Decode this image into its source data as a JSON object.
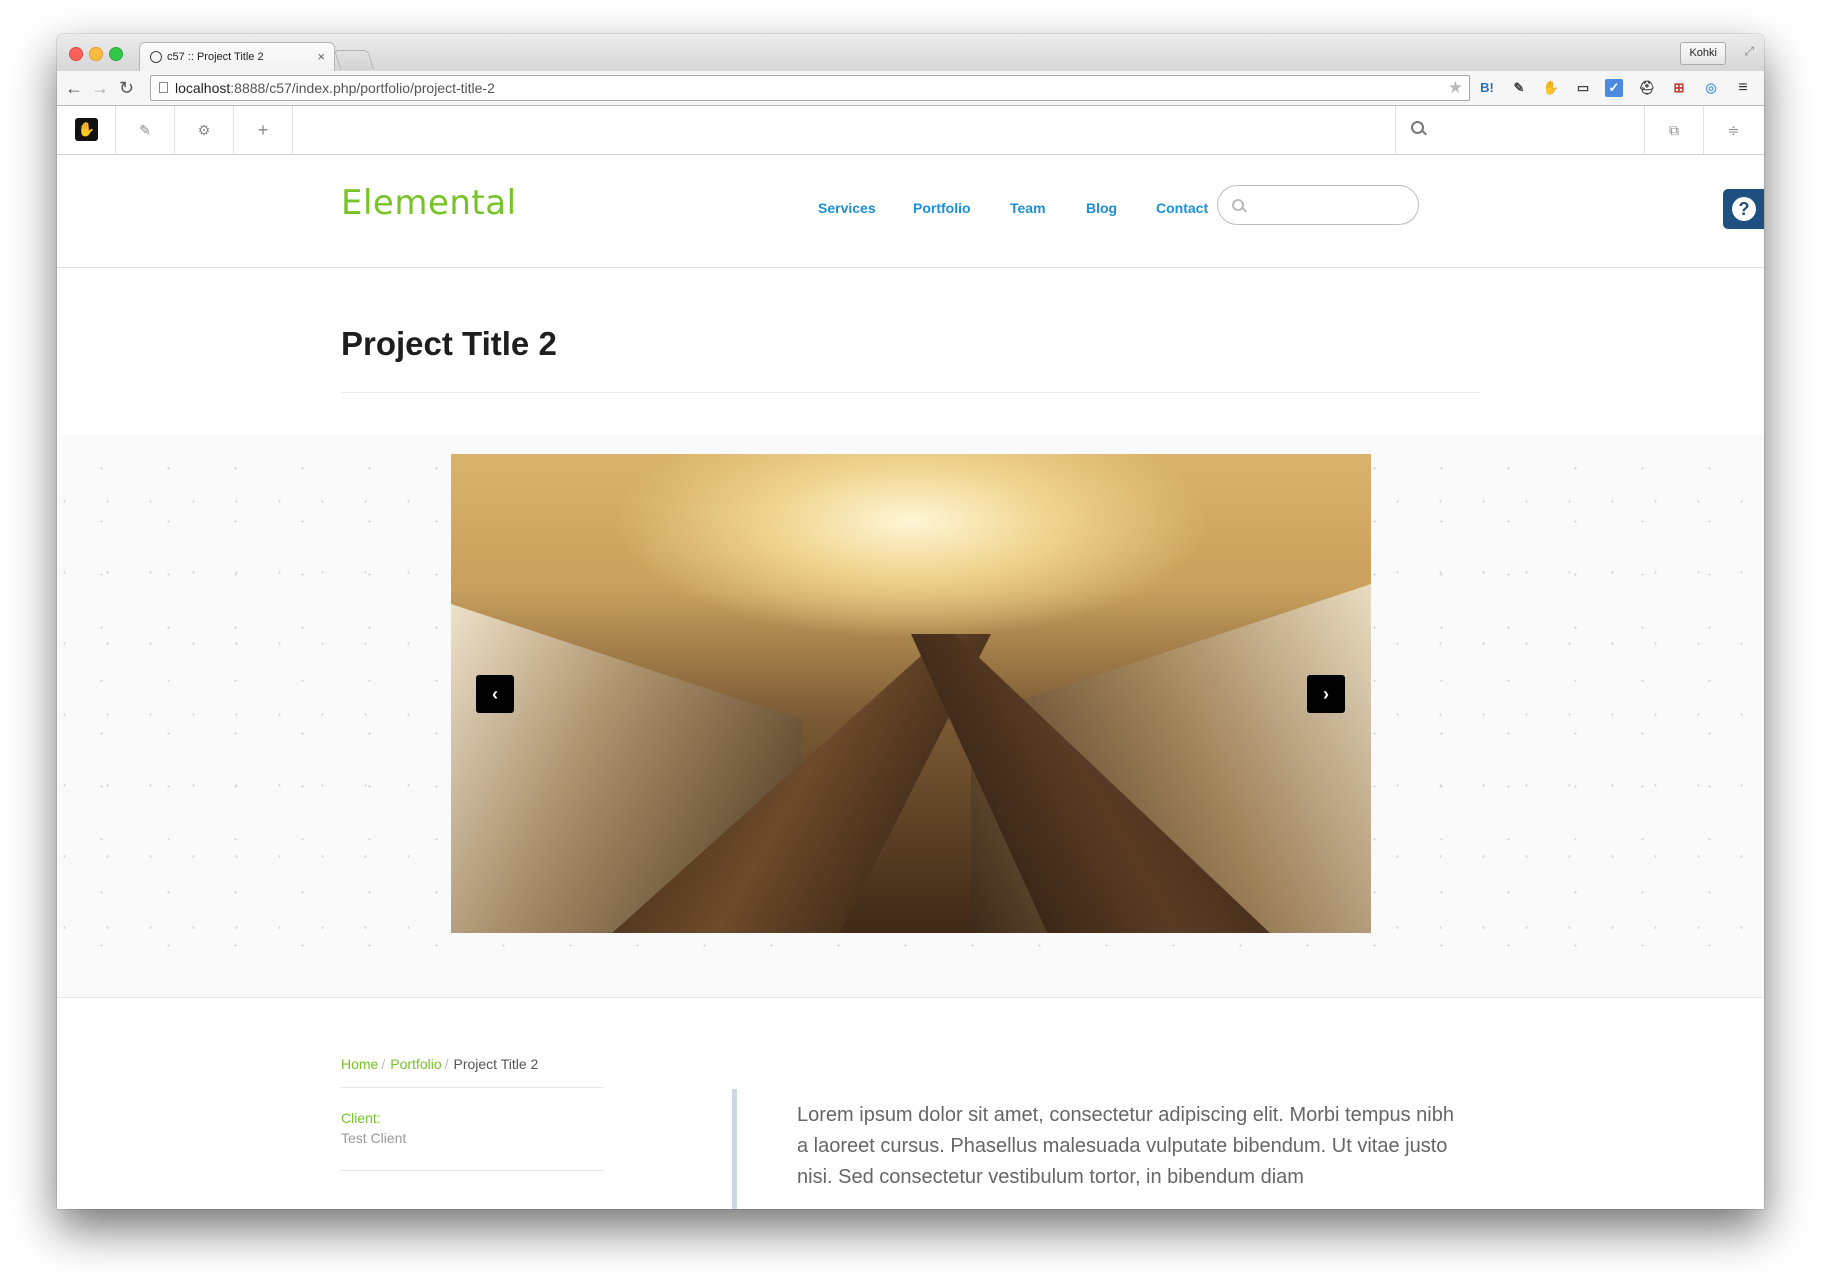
{
  "browser": {
    "tab_title": "c57 :: Project Title 2",
    "tab_close": "×",
    "profile_name": "Kohki",
    "url_host": "localhost",
    "url_rest": ":8888/c57/index.php/portfolio/project-title-2",
    "extensions": [
      "B!",
      "✎",
      "✋",
      "▭",
      "✓",
      "⛑",
      "⊞",
      "◎",
      "≡"
    ]
  },
  "cms": {
    "edit_glyph": "✎",
    "settings_glyph": "⚙",
    "add_glyph": "+",
    "pages_glyph": "⧉",
    "panel_glyph": "≑",
    "logo_glyph": "✋"
  },
  "site": {
    "brand": "Elemental",
    "nav": [
      "Services",
      "Portfolio",
      "Team",
      "Blog",
      "Contact"
    ],
    "help_glyph": "?"
  },
  "project": {
    "title": "Project Title 2",
    "prev_glyph": "‹",
    "next_glyph": "›",
    "breadcrumb": {
      "home": "Home",
      "portfolio": "Portfolio",
      "current": "Project Title 2",
      "sep": "/"
    },
    "client_label": "Client:",
    "client_value": "Test Client",
    "body": "Lorem ipsum dolor sit amet, consectetur adipiscing elit. Morbi tempus nibh a laoreet cursus. Phasellus malesuada vulputate bibendum. Ut vitae justo nisi. Sed consectetur vestibulum tortor, in bibendum diam"
  }
}
